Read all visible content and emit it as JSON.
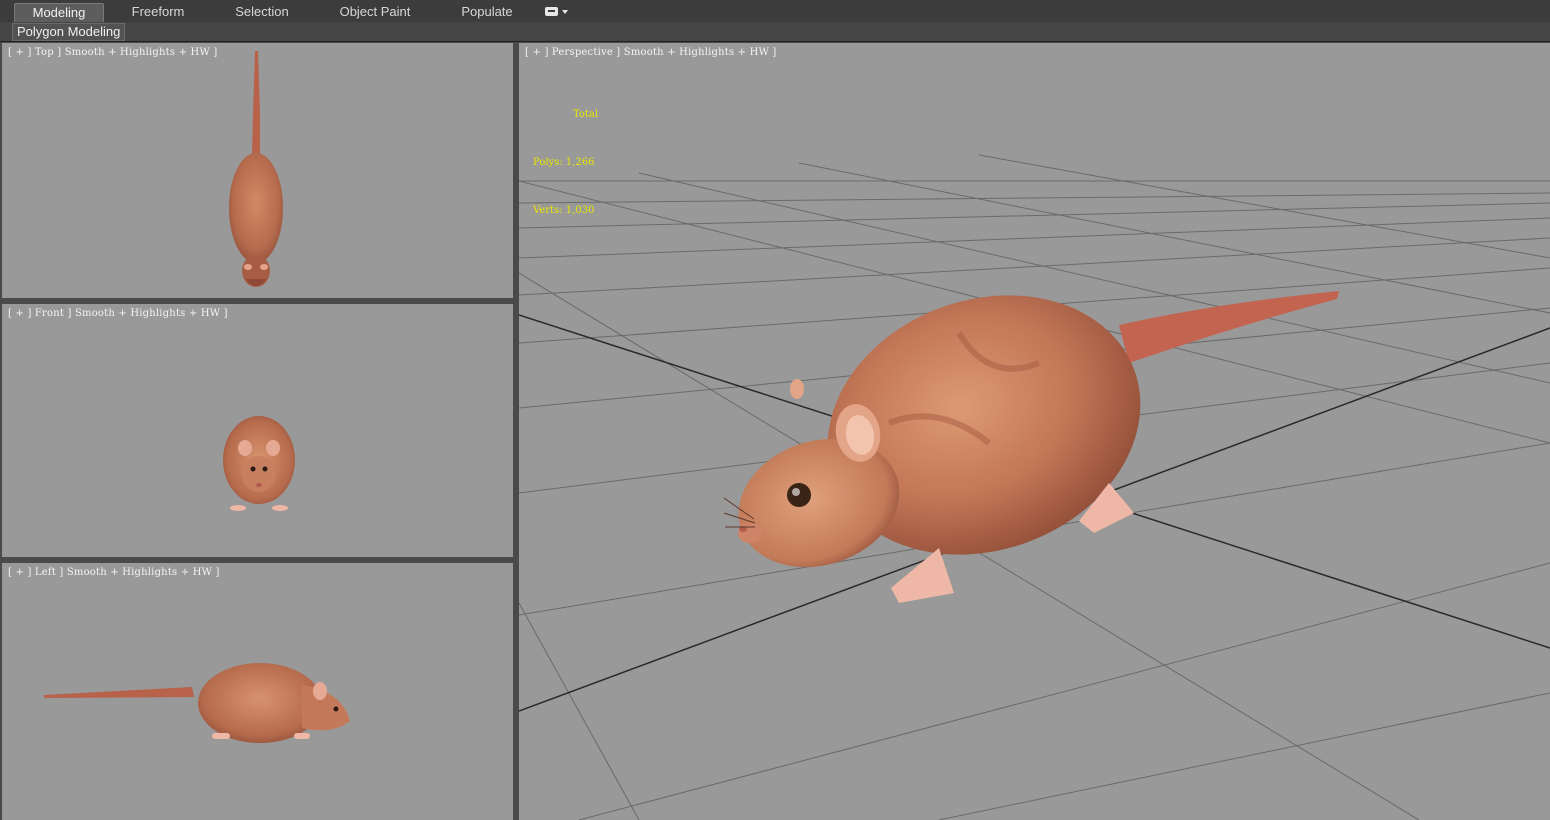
{
  "ribbon": {
    "tabs": [
      {
        "label": "Modeling",
        "active": true
      },
      {
        "label": "Freeform",
        "active": false
      },
      {
        "label": "Selection",
        "active": false
      },
      {
        "label": "Object Paint",
        "active": false
      },
      {
        "label": "Populate",
        "active": false
      }
    ],
    "menu_icon": "ribbon-options-icon",
    "panel_label": "Polygon Modeling"
  },
  "viewports": {
    "top": {
      "label": "[ + ] Top ] Smooth + Highlights + HW ]"
    },
    "front": {
      "label": "[ + ] Front ] Smooth + Highlights + HW ]"
    },
    "left": {
      "label": "[ + ] Left ] Smooth + Highlights + HW ]"
    },
    "perspective": {
      "label": "[ + ] Perspective ] Smooth + Highlights + HW ]",
      "stats": {
        "header": "Total",
        "polys_label": "Polys:",
        "polys_value": "1,266",
        "verts_label": "Verts:",
        "verts_value": "1,030"
      }
    }
  },
  "colors": {
    "viewport_bg": "#999999",
    "stats_text": "#e8e800",
    "rat_fur": "#c0765a",
    "rat_skin": "#efb8a6"
  }
}
